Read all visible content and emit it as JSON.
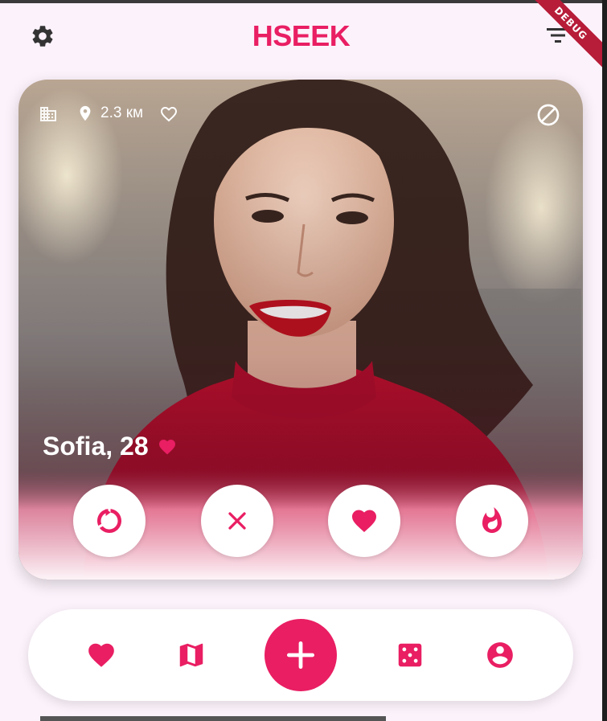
{
  "app": {
    "title": "HSEEK",
    "debug_label": "DEBUG",
    "accent_color": "#e91e63"
  },
  "header": {
    "settings_icon": "gear-icon",
    "filter_icon": "filter-icon"
  },
  "profile": {
    "distance": "2.3 км",
    "name_age": "Sofia, 28",
    "icons": [
      "building-icon",
      "location-pin-icon",
      "heart-outline-icon",
      "block-icon",
      "heart-icon"
    ]
  },
  "actions": [
    "rewind-icon",
    "close-icon",
    "heart-icon",
    "fire-icon"
  ],
  "bottom_nav": [
    "heart-icon",
    "map-icon",
    "add-icon",
    "dice-icon",
    "account-icon"
  ]
}
